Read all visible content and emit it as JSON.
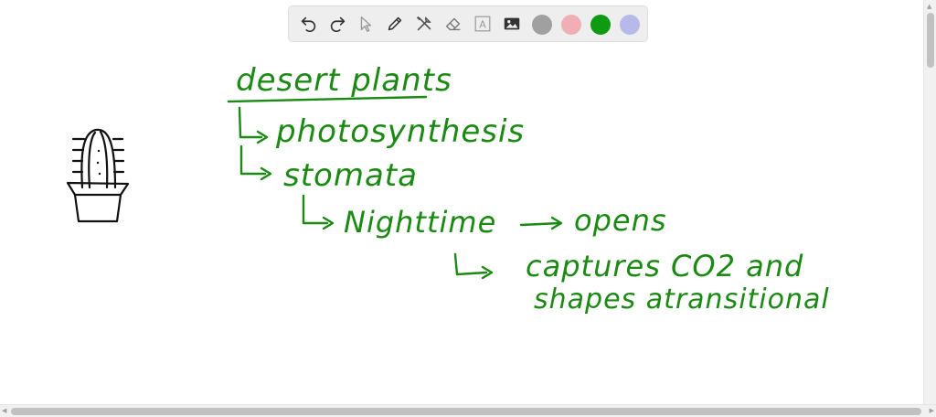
{
  "toolbar": {
    "tools": [
      {
        "name": "undo-icon"
      },
      {
        "name": "redo-icon"
      },
      {
        "name": "pointer-icon"
      },
      {
        "name": "pen-icon"
      },
      {
        "name": "tools-icon"
      },
      {
        "name": "eraser-icon"
      },
      {
        "name": "text-icon",
        "glyph": "A"
      },
      {
        "name": "image-icon"
      }
    ],
    "colors": [
      {
        "name": "gray",
        "hex": "#a0a0a0"
      },
      {
        "name": "pink",
        "hex": "#f0aeb5"
      },
      {
        "name": "green",
        "hex": "#0f9a14"
      },
      {
        "name": "lavender",
        "hex": "#b9b8ea"
      }
    ]
  },
  "notes": {
    "title": "desert plants",
    "line1": "photosynthesis",
    "line2": "stomata",
    "line3": "Nighttime",
    "line3_rest": "opens",
    "line4": "captures CO2 and",
    "line5": "shapes atransitional"
  },
  "ink_color": "#1a8a12"
}
